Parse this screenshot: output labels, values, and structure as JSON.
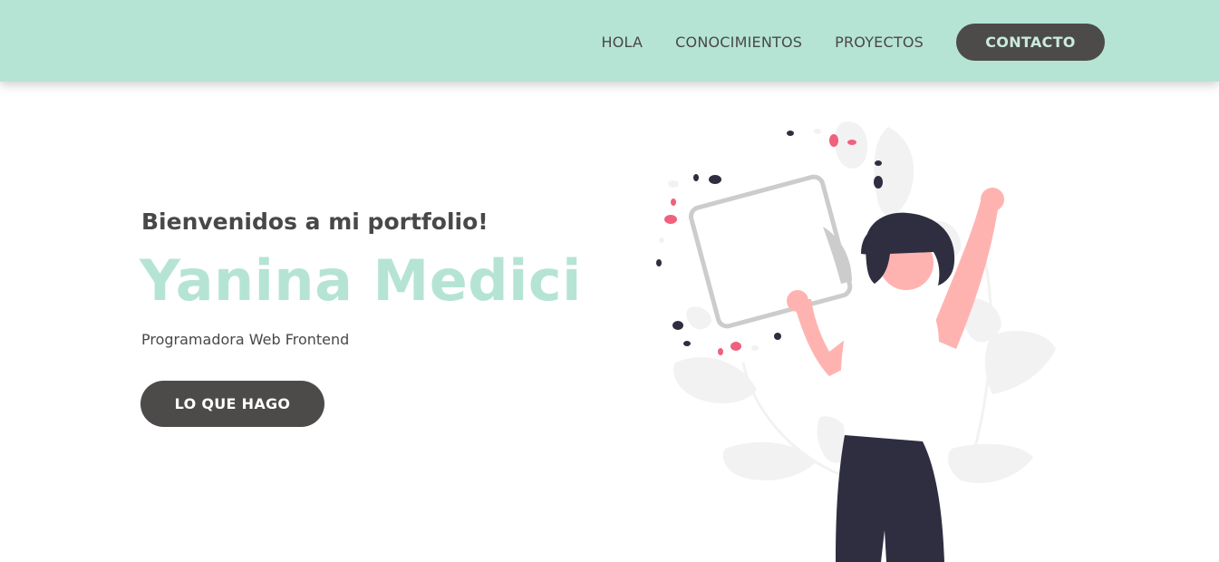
{
  "nav": {
    "items": [
      {
        "label": "HOLA"
      },
      {
        "label": "CONOCIMIENTOS"
      },
      {
        "label": "PROYECTOS"
      }
    ],
    "cta_label": "CONTACTO"
  },
  "hero": {
    "greeting": "Bienvenidos a mi portfolio!",
    "name": "Yanina Medici",
    "role": "Programadora Web Frontend",
    "button_label": "LO QUE HAGO"
  },
  "illustration": {
    "icon": "woman-holding-tablet-illustration"
  },
  "colors": {
    "accent_mint": "#b5e4d5",
    "dark_button": "#4d4a4a",
    "text": "#4a4747",
    "skin": "#ffb3b1",
    "pants": "#2f2e41",
    "leaves": "#f2f2f2",
    "confetti_pink": "#f0617d"
  }
}
